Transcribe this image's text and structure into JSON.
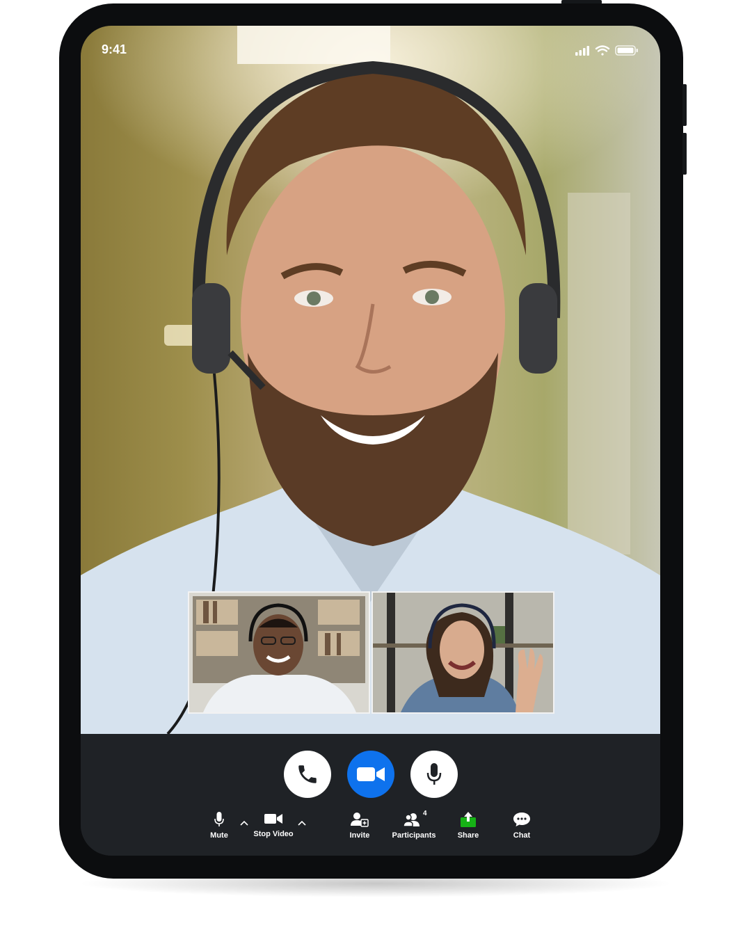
{
  "status_bar": {
    "time": "9:41"
  },
  "call": {
    "buttons": [
      {
        "name": "phone",
        "icon": "phone-icon"
      },
      {
        "name": "video",
        "icon": "video-camera-icon",
        "color": "#0e72ed"
      },
      {
        "name": "mic",
        "icon": "microphone-icon"
      }
    ]
  },
  "toolbar": {
    "items": [
      {
        "label": "Mute",
        "icon": "microphone-icon"
      },
      {
        "label": "Stop Video",
        "icon": "video-camera-icon"
      },
      {
        "label": "Invite",
        "icon": "invite-user-icon"
      },
      {
        "label": "Participants",
        "icon": "participants-icon",
        "count": "4"
      },
      {
        "label": "Share",
        "icon": "share-icon",
        "color": "#16b216"
      },
      {
        "label": "Chat",
        "icon": "chat-bubble-icon"
      }
    ]
  },
  "colors": {
    "toolbar_bg": "#1f2226",
    "accent": "#0e72ed",
    "share": "#16b216",
    "device_frame": "#0c0d0f"
  }
}
